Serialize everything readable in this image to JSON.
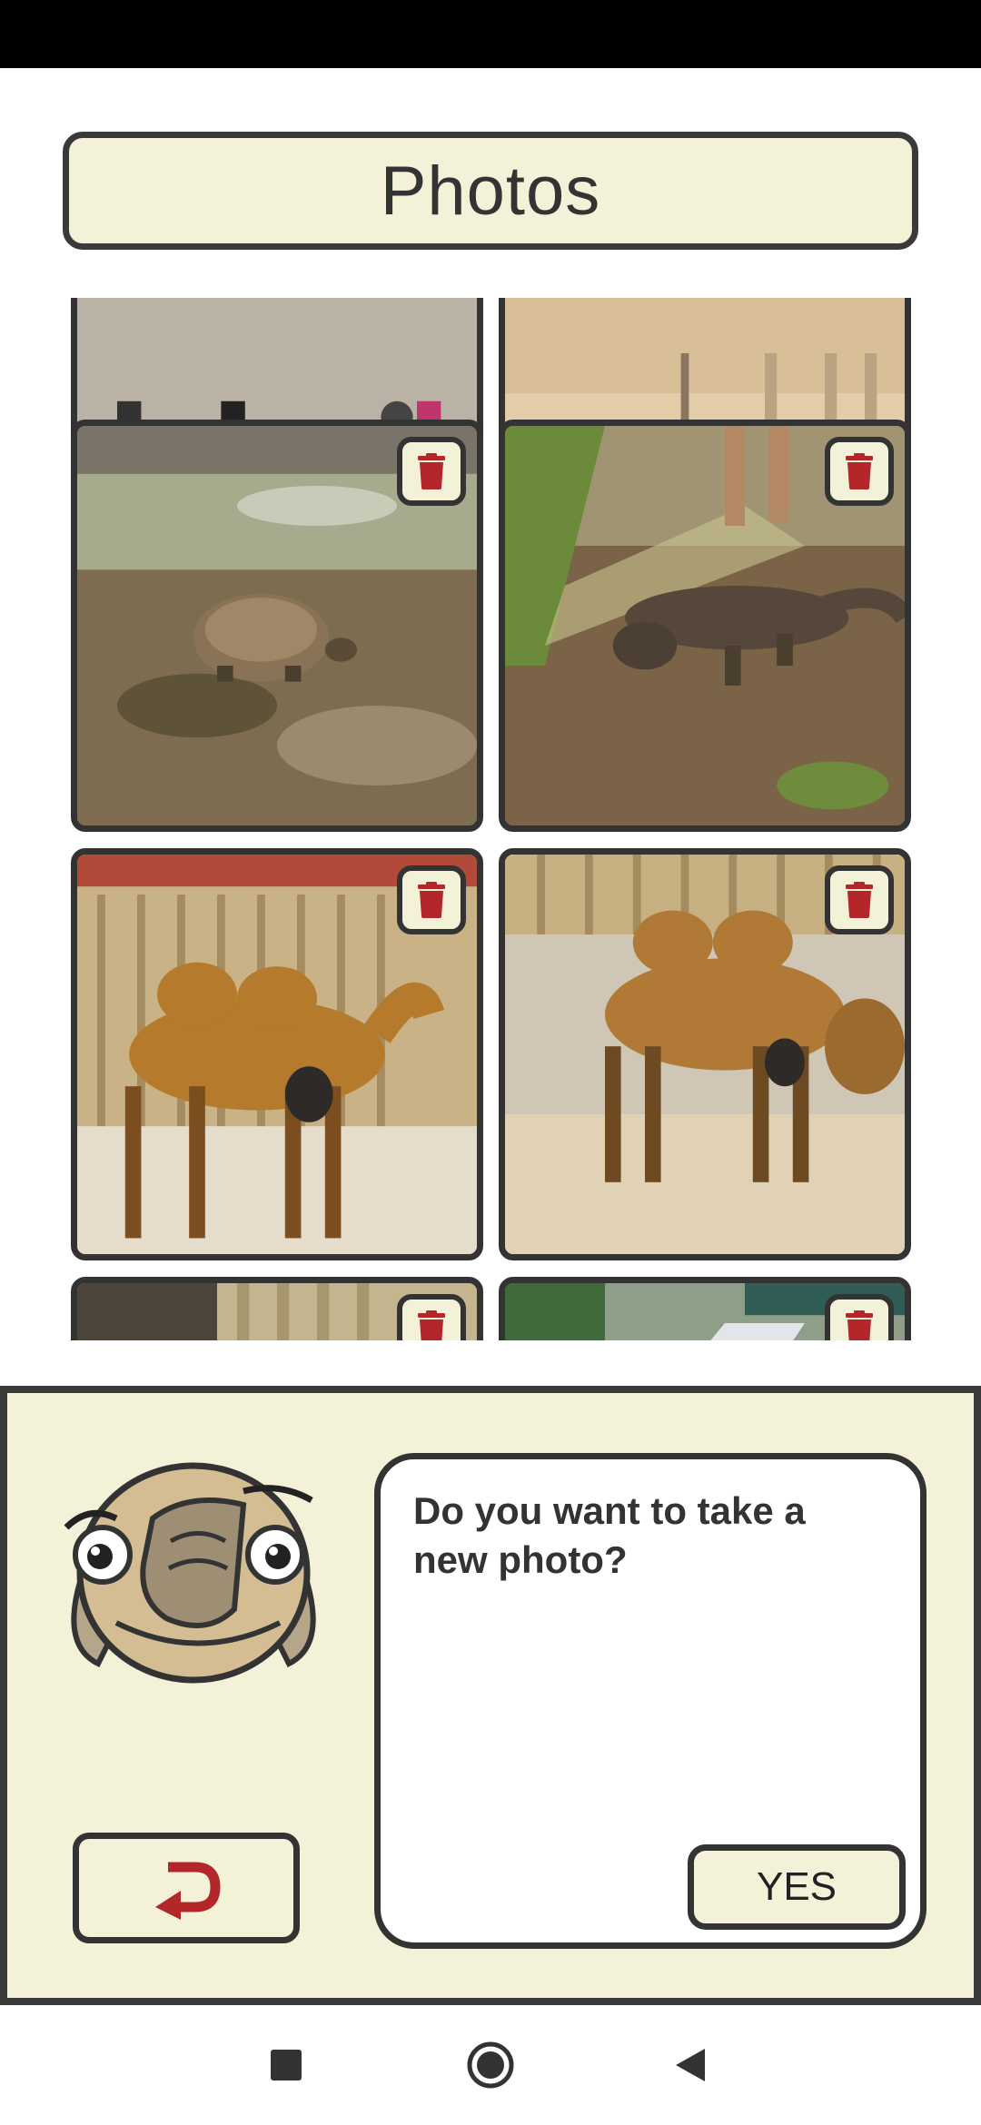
{
  "app": {
    "title": "Photos"
  },
  "colors": {
    "panel": "#f3f2d9",
    "border": "#333333",
    "trash": "#b3272b",
    "back_arrow": "#b3272b"
  },
  "photos": [
    {
      "subject": "partial-photo-people",
      "has_delete": false
    },
    {
      "subject": "partial-photo-enclosure",
      "has_delete": false
    },
    {
      "subject": "tortoise",
      "has_delete": true,
      "delete_icon": "trash-icon"
    },
    {
      "subject": "komodo-dragon",
      "has_delete": true,
      "delete_icon": "trash-icon"
    },
    {
      "subject": "camel",
      "has_delete": true,
      "delete_icon": "trash-icon"
    },
    {
      "subject": "camel",
      "has_delete": true,
      "delete_icon": "trash-icon"
    },
    {
      "subject": "partial-photo-enclosure",
      "has_delete": true,
      "delete_icon": "trash-icon"
    },
    {
      "subject": "partial-photo-trees",
      "has_delete": true,
      "delete_icon": "trash-icon"
    }
  ],
  "dialog": {
    "message": "Do you want to take a new photo?",
    "confirm_label": "YES"
  },
  "back_button": {
    "icon": "return-arrow-icon"
  },
  "navigation": {
    "items": [
      "stop-square-icon",
      "home-circle-icon",
      "back-triangle-icon"
    ]
  }
}
